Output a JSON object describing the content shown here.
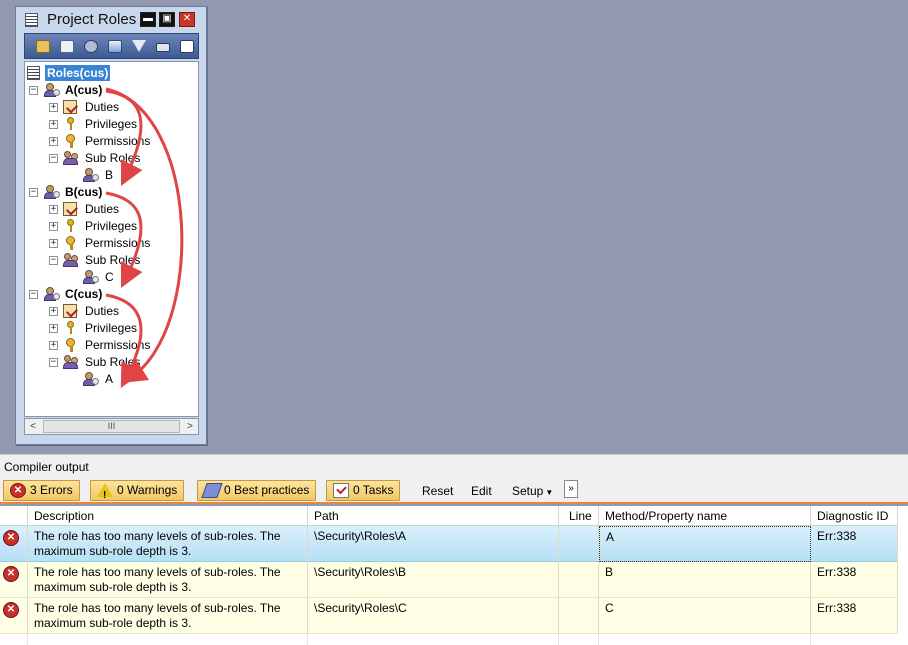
{
  "window": {
    "title": "Project Roles",
    "controls": {
      "minimize": "▬",
      "maximize": "▣",
      "close": "✕"
    }
  },
  "toolbar_icons": [
    "open-icon",
    "properties-icon",
    "compile-icon",
    "sort-icon",
    "filter-icon",
    "keyboard-icon",
    "new-icon"
  ],
  "tree": {
    "root": "Roles(cus)",
    "roles": [
      {
        "name": "A(cus)",
        "children": [
          {
            "label": "Duties",
            "icon": "duty-icon"
          },
          {
            "label": "Privileges",
            "icon": "privilege-icon"
          },
          {
            "label": "Permissions",
            "icon": "permission-icon"
          },
          {
            "label": "Sub Roles",
            "icon": "sub-roles-icon"
          }
        ],
        "sub_role": "B"
      },
      {
        "name": "B(cus)",
        "children": [
          {
            "label": "Duties",
            "icon": "duty-icon"
          },
          {
            "label": "Privileges",
            "icon": "privilege-icon"
          },
          {
            "label": "Permissions",
            "icon": "permission-icon"
          },
          {
            "label": "Sub Roles",
            "icon": "sub-roles-icon"
          }
        ],
        "sub_role": "C"
      },
      {
        "name": "C(cus)",
        "children": [
          {
            "label": "Duties",
            "icon": "duty-icon"
          },
          {
            "label": "Privileges",
            "icon": "privilege-icon"
          },
          {
            "label": "Permissions",
            "icon": "permission-icon"
          },
          {
            "label": "Sub Roles",
            "icon": "sub-roles-icon"
          }
        ],
        "sub_role": "A"
      }
    ],
    "scroll_thumb": "III",
    "scroll_left": "<",
    "scroll_right": ">"
  },
  "compiler": {
    "title": "Compiler output",
    "filters": {
      "errors": "3 Errors",
      "warnings": "0 Warnings",
      "best_practices": "0 Best practices",
      "tasks": "0 Tasks"
    },
    "actions": {
      "reset": "Reset",
      "edit": "Edit",
      "setup": "Setup"
    },
    "more": "»",
    "columns": [
      "Description",
      "Path",
      "Line",
      "Method/Property name",
      "Diagnostic ID"
    ],
    "rows": [
      {
        "description": "The role has too many levels of sub-roles. The maximum sub-role depth is 3.",
        "path": "\\Security\\Roles\\A",
        "line": "",
        "method": "A",
        "diag": "Err:338"
      },
      {
        "description": "The role has too many levels of sub-roles. The maximum sub-role depth is 3.",
        "path": "\\Security\\Roles\\B",
        "line": "",
        "method": "B",
        "diag": "Err:338"
      },
      {
        "description": "The role has too many levels of sub-roles. The maximum sub-role depth is 3.",
        "path": "\\Security\\Roles\\C",
        "line": "",
        "method": "C",
        "diag": "Err:338"
      }
    ]
  },
  "colors": {
    "desktop": "#9398b1",
    "annotation_arrow": "#e04545",
    "selection": "#3a84d6",
    "error": "#c8302a",
    "row_highlight": "#ffffe6"
  }
}
